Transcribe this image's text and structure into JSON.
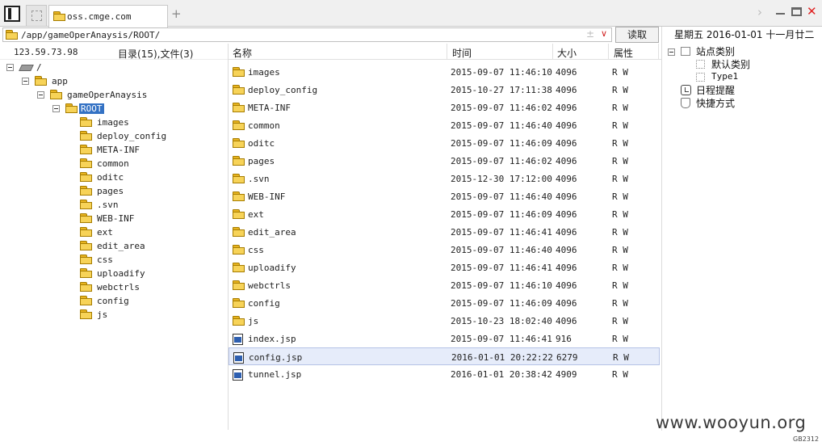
{
  "tab": {
    "label": "oss.cmge.com"
  },
  "address": {
    "path": "/app/gameOperAnaysis/ROOT/",
    "read_label": "读取"
  },
  "left_header": {
    "ip": "123.59.73.98",
    "counts": "目录(15),文件(3)"
  },
  "tree": {
    "root": "/",
    "app": "app",
    "project": "gameOperAnaysis",
    "selected": "ROOT",
    "children": [
      "images",
      "deploy_config",
      "META-INF",
      "common",
      "oditc",
      "pages",
      ".svn",
      "WEB-INF",
      "ext",
      "edit_area",
      "css",
      "uploadify",
      "webctrls",
      "config",
      "js"
    ]
  },
  "columns": {
    "name": "名称",
    "time": "时间",
    "size": "大小",
    "attr": "属性"
  },
  "files": [
    {
      "name": "images",
      "time": "2015-09-07 11:46:10",
      "size": "4096",
      "attr": "R W",
      "type": "folder"
    },
    {
      "name": "deploy_config",
      "time": "2015-10-27 17:11:38",
      "size": "4096",
      "attr": "R W",
      "type": "folder"
    },
    {
      "name": "META-INF",
      "time": "2015-09-07 11:46:02",
      "size": "4096",
      "attr": "R W",
      "type": "folder"
    },
    {
      "name": "common",
      "time": "2015-09-07 11:46:40",
      "size": "4096",
      "attr": "R W",
      "type": "folder"
    },
    {
      "name": "oditc",
      "time": "2015-09-07 11:46:09",
      "size": "4096",
      "attr": "R W",
      "type": "folder"
    },
    {
      "name": "pages",
      "time": "2015-09-07 11:46:02",
      "size": "4096",
      "attr": "R W",
      "type": "folder"
    },
    {
      "name": ".svn",
      "time": "2015-12-30 17:12:00",
      "size": "4096",
      "attr": "R W",
      "type": "folder"
    },
    {
      "name": "WEB-INF",
      "time": "2015-09-07 11:46:40",
      "size": "4096",
      "attr": "R W",
      "type": "folder"
    },
    {
      "name": "ext",
      "time": "2015-09-07 11:46:09",
      "size": "4096",
      "attr": "R W",
      "type": "folder"
    },
    {
      "name": "edit_area",
      "time": "2015-09-07 11:46:41",
      "size": "4096",
      "attr": "R W",
      "type": "folder"
    },
    {
      "name": "css",
      "time": "2015-09-07 11:46:40",
      "size": "4096",
      "attr": "R W",
      "type": "folder"
    },
    {
      "name": "uploadify",
      "time": "2015-09-07 11:46:41",
      "size": "4096",
      "attr": "R W",
      "type": "folder"
    },
    {
      "name": "webctrls",
      "time": "2015-09-07 11:46:10",
      "size": "4096",
      "attr": "R W",
      "type": "folder"
    },
    {
      "name": "config",
      "time": "2015-09-07 11:46:09",
      "size": "4096",
      "attr": "R W",
      "type": "folder"
    },
    {
      "name": "js",
      "time": "2015-10-23 18:02:40",
      "size": "4096",
      "attr": "R W",
      "type": "folder"
    },
    {
      "name": "index.jsp",
      "time": "2015-09-07 11:46:41",
      "size": "916",
      "attr": "R W",
      "type": "jsp"
    },
    {
      "name": "config.jsp",
      "time": "2016-01-01 20:22:22",
      "size": "6279",
      "attr": "R W",
      "type": "jsp",
      "selected": true
    },
    {
      "name": "tunnel.jsp",
      "time": "2016-01-01 20:38:42",
      "size": "4909",
      "attr": "R W",
      "type": "jsp"
    }
  ],
  "right": {
    "date": "星期五 2016-01-01 十一月廿二",
    "site_category": "站点类别",
    "default_category": "默认类别",
    "type1": "Type1",
    "schedule": "日程提醒",
    "shortcuts": "快捷方式"
  },
  "footer": {
    "watermark": "www.wooyun.org",
    "encoding": "GB2312"
  },
  "colors": {
    "selection": "#3472c4",
    "row_selected": "#e6ecfa",
    "folder": "#f7d358",
    "close": "#e02020"
  }
}
